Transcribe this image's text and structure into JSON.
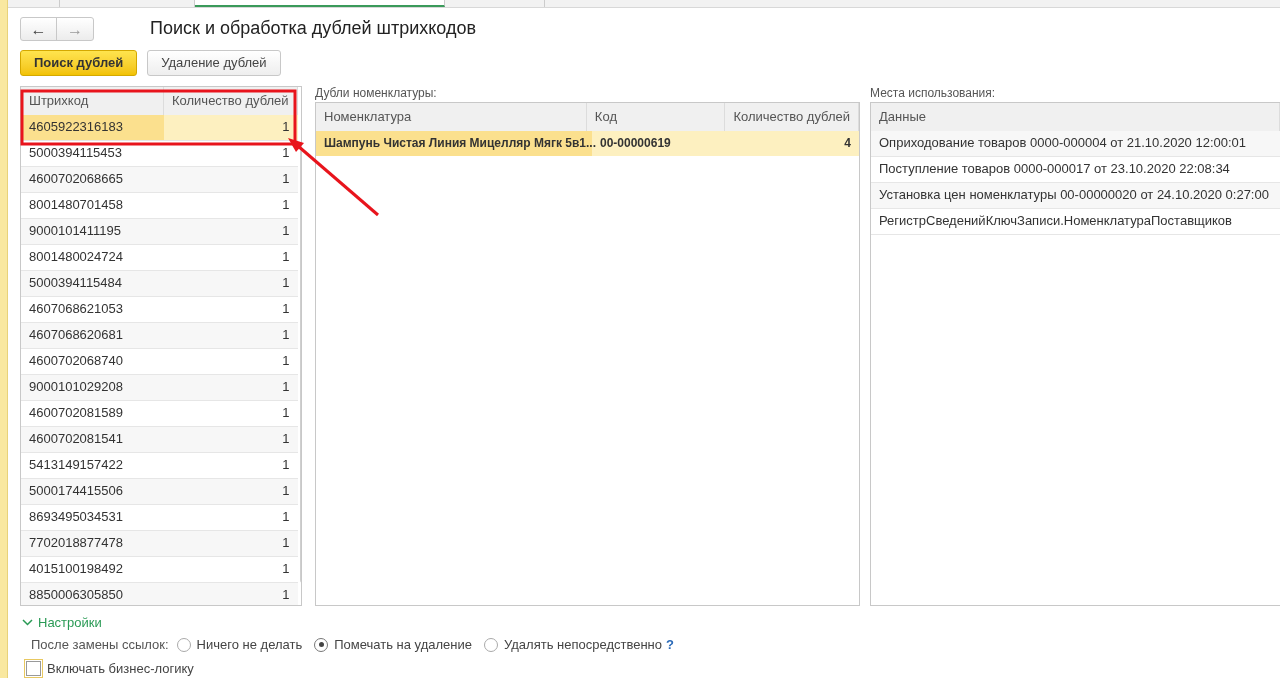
{
  "nav": {
    "back": "←",
    "forward": "→"
  },
  "title": "Поиск и обработка дублей штрихкодов",
  "actions": [
    {
      "label": "Поиск дублей",
      "kind": "primary"
    },
    {
      "label": "Удаление дублей",
      "kind": "secondary"
    }
  ],
  "barcodes": {
    "columns": [
      "Штрихкод",
      "Количество дублей"
    ],
    "rows": [
      {
        "barcode": "4605922316183",
        "count": "1",
        "selected": true
      },
      {
        "barcode": "5000394115453",
        "count": "1",
        "selected": false
      },
      {
        "barcode": "4600702068665",
        "count": "1",
        "selected": false
      },
      {
        "barcode": "8001480701458",
        "count": "1",
        "selected": false
      },
      {
        "barcode": "9000101411195",
        "count": "1",
        "selected": false
      },
      {
        "barcode": "8001480024724",
        "count": "1",
        "selected": false
      },
      {
        "barcode": "5000394115484",
        "count": "1",
        "selected": false
      },
      {
        "barcode": "4607068621053",
        "count": "1",
        "selected": false
      },
      {
        "barcode": "4607068620681",
        "count": "1",
        "selected": false
      },
      {
        "barcode": "4600702068740",
        "count": "1",
        "selected": false
      },
      {
        "barcode": "9000101029208",
        "count": "1",
        "selected": false
      },
      {
        "barcode": "4600702081589",
        "count": "1",
        "selected": false
      },
      {
        "barcode": "4600702081541",
        "count": "1",
        "selected": false
      },
      {
        "barcode": "5413149157422",
        "count": "1",
        "selected": false
      },
      {
        "barcode": "5000174415506",
        "count": "1",
        "selected": false
      },
      {
        "barcode": "8693495034531",
        "count": "1",
        "selected": false
      },
      {
        "barcode": "7702018877478",
        "count": "1",
        "selected": false
      },
      {
        "barcode": "4015100198492",
        "count": "1",
        "selected": false
      },
      {
        "barcode": "8850006305850",
        "count": "1",
        "selected": false
      }
    ]
  },
  "duplicates": {
    "label": "Дубли номенклатуры:",
    "columns": [
      "Номенклатура",
      "Код",
      "Количество дублей"
    ],
    "rows": [
      {
        "item": "Шампунь Чистая Линия Мицелляр Мягк 5в1...",
        "code": "00-00000619",
        "count": "4",
        "selected": true
      }
    ]
  },
  "usages": {
    "label": "Места использования:",
    "columns": [
      "Данные"
    ],
    "rows": [
      {
        "data": "Оприходование товаров 0000-000004 от 21.10.2020 12:00:01"
      },
      {
        "data": "Поступление товаров 0000-000017 от 23.10.2020 22:08:34"
      },
      {
        "data": "Установка цен номенклатуры 00-00000020 от 24.10.2020 0:27:00"
      },
      {
        "data": "РегистрСведенийКлючЗаписи.НоменклатураПоставщиков"
      }
    ]
  },
  "settings": {
    "title": "Настройки",
    "expanded": true,
    "replace_label": "После замены ссылок:",
    "options": [
      {
        "label": "Ничего не делать",
        "selected": false
      },
      {
        "label": "Помечать на удаление",
        "selected": true
      },
      {
        "label": "Удалять непосредственно",
        "selected": false
      }
    ],
    "help": "?",
    "business_logic": {
      "label": "Включать бизнес-логику",
      "checked": false
    }
  }
}
